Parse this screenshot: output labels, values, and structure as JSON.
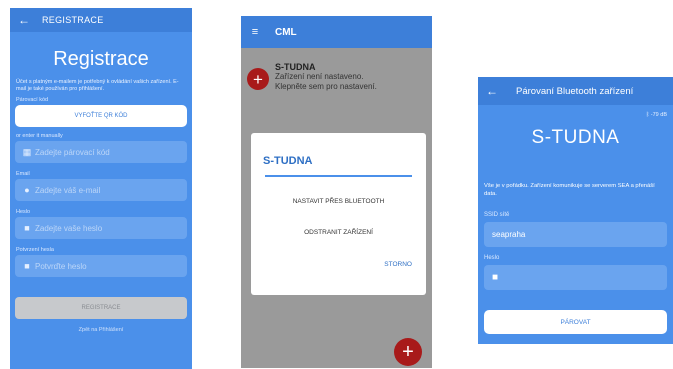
{
  "screen1": {
    "back_icon": "arrow-left-icon",
    "appbar_title": "REGISTRACE",
    "heading": "Registrace",
    "intro": "Účet s platným e-mailem je potřebný k ovládání vašich zařízení. E-mail je také používán pro přihlášení.",
    "pairing_label": "Párovací kód",
    "qr_button": "VYFOŤTE QR KÓD",
    "manual_label": "or enter it manually",
    "pairing_placeholder": "Zadejte párovací kód",
    "email_label": "Email",
    "email_placeholder": "Zadejte váš e-mail",
    "password_label": "Heslo",
    "password_placeholder": "Zadejte vaše heslo",
    "confirm_label": "Potvrzení hesla",
    "confirm_placeholder": "Potvrďte heslo",
    "submit_button": "REGISTRACE",
    "bottom_text": "Zpět na Přihlášení",
    "colors": {
      "primary": "#4b90ea",
      "appbar": "#3d7fd9",
      "disabled": "#c7c9cc"
    }
  },
  "screen2": {
    "menu_icon": "hamburger-menu-icon",
    "appbar_title": "CML",
    "device_name": "S-TUDNA",
    "device_status": "Zařízení není nastaveno.",
    "device_hint": "Klepněte sem pro nastavení.",
    "dialog": {
      "title": "S-TUDNA",
      "option_bluetooth": "NASTAVIT PŘES BLUETOOTH",
      "option_remove": "ODSTRANIT ZAŘÍZENÍ",
      "cancel": "STORNO"
    },
    "fab_icon": "plus-icon",
    "colors": {
      "accent_red": "#a81a1a",
      "overlay": "#9a9a9a"
    }
  },
  "screen3": {
    "back_icon": "arrow-left-icon",
    "appbar_title": "Párovaní Bluetooth zařízení",
    "signal": "-79 dB",
    "heading": "S-TUDNA",
    "intro": "Vše je v pořádku. Zařízení komunikuje se serverem SEA a přenáší data.",
    "ssid_label": "SSID sítě",
    "ssid_value": "seapraha",
    "password_label": "Heslo",
    "pair_button": "PÁROVAT"
  }
}
